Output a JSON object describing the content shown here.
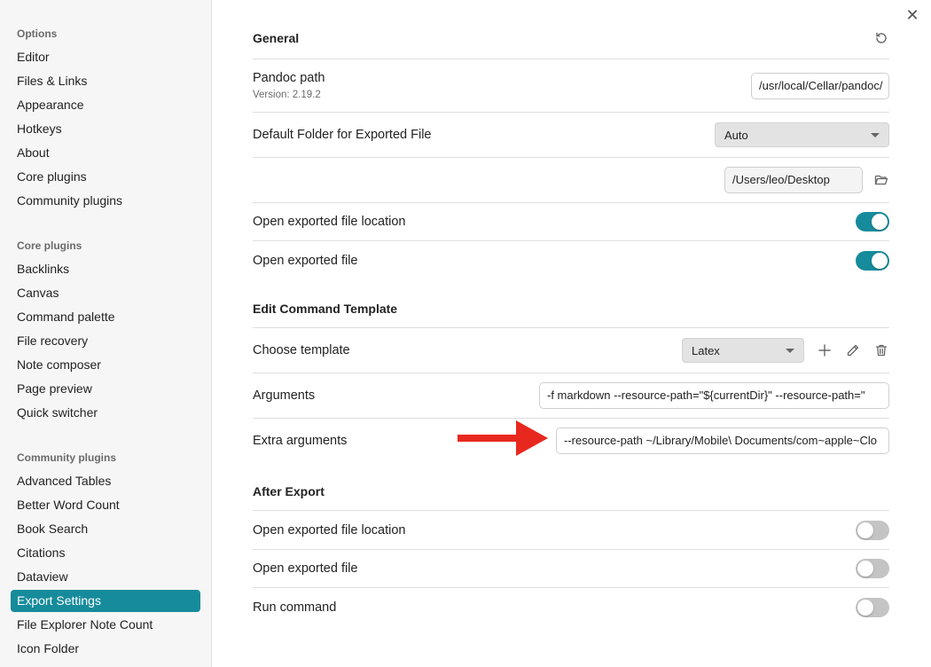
{
  "sidebar": {
    "sections": [
      {
        "title": "Options",
        "items": [
          "Editor",
          "Files & Links",
          "Appearance",
          "Hotkeys",
          "About",
          "Core plugins",
          "Community plugins"
        ]
      },
      {
        "title": "Core plugins",
        "items": [
          "Backlinks",
          "Canvas",
          "Command palette",
          "File recovery",
          "Note composer",
          "Page preview",
          "Quick switcher"
        ]
      },
      {
        "title": "Community plugins",
        "items": [
          "Advanced Tables",
          "Better Word Count",
          "Book Search",
          "Citations",
          "Dataview",
          "Export Settings",
          "File Explorer Note Count",
          "Icon Folder"
        ]
      }
    ],
    "active_item": "Export Settings"
  },
  "close_icon": "close-icon",
  "general": {
    "title": "General",
    "reset_icon": "reset-icon",
    "pandoc_path": {
      "label": "Pandoc path",
      "desc": "Version: 2.19.2",
      "value": "/usr/local/Cellar/pandoc/"
    },
    "default_folder": {
      "label": "Default Folder for Exported File",
      "selected": "Auto"
    },
    "folder_path": {
      "value": "/Users/leo/Desktop",
      "icon": "folder-icon"
    },
    "open_location": {
      "label": "Open exported file location",
      "on": true
    },
    "open_file": {
      "label": "Open exported file",
      "on": true
    }
  },
  "edit_template": {
    "title": "Edit Command Template",
    "choose_template": {
      "label": "Choose template",
      "selected": "Latex",
      "icons": [
        "plus-icon",
        "pencil-icon",
        "trash-icon"
      ]
    },
    "arguments": {
      "label": "Arguments",
      "value": "-f markdown --resource-path=\"${currentDir}\" --resource-path=\""
    },
    "extra_arguments": {
      "label": "Extra arguments",
      "value": "--resource-path ~/Library/Mobile\\ Documents/com~apple~Clo"
    }
  },
  "after_export": {
    "title": "After Export",
    "open_location": {
      "label": "Open exported file location",
      "on": false
    },
    "open_file": {
      "label": "Open exported file",
      "on": false
    },
    "run_command": {
      "label": "Run command",
      "on": false
    }
  },
  "colors": {
    "accent": "#168b9b",
    "annotation_arrow": "#e8281e"
  }
}
